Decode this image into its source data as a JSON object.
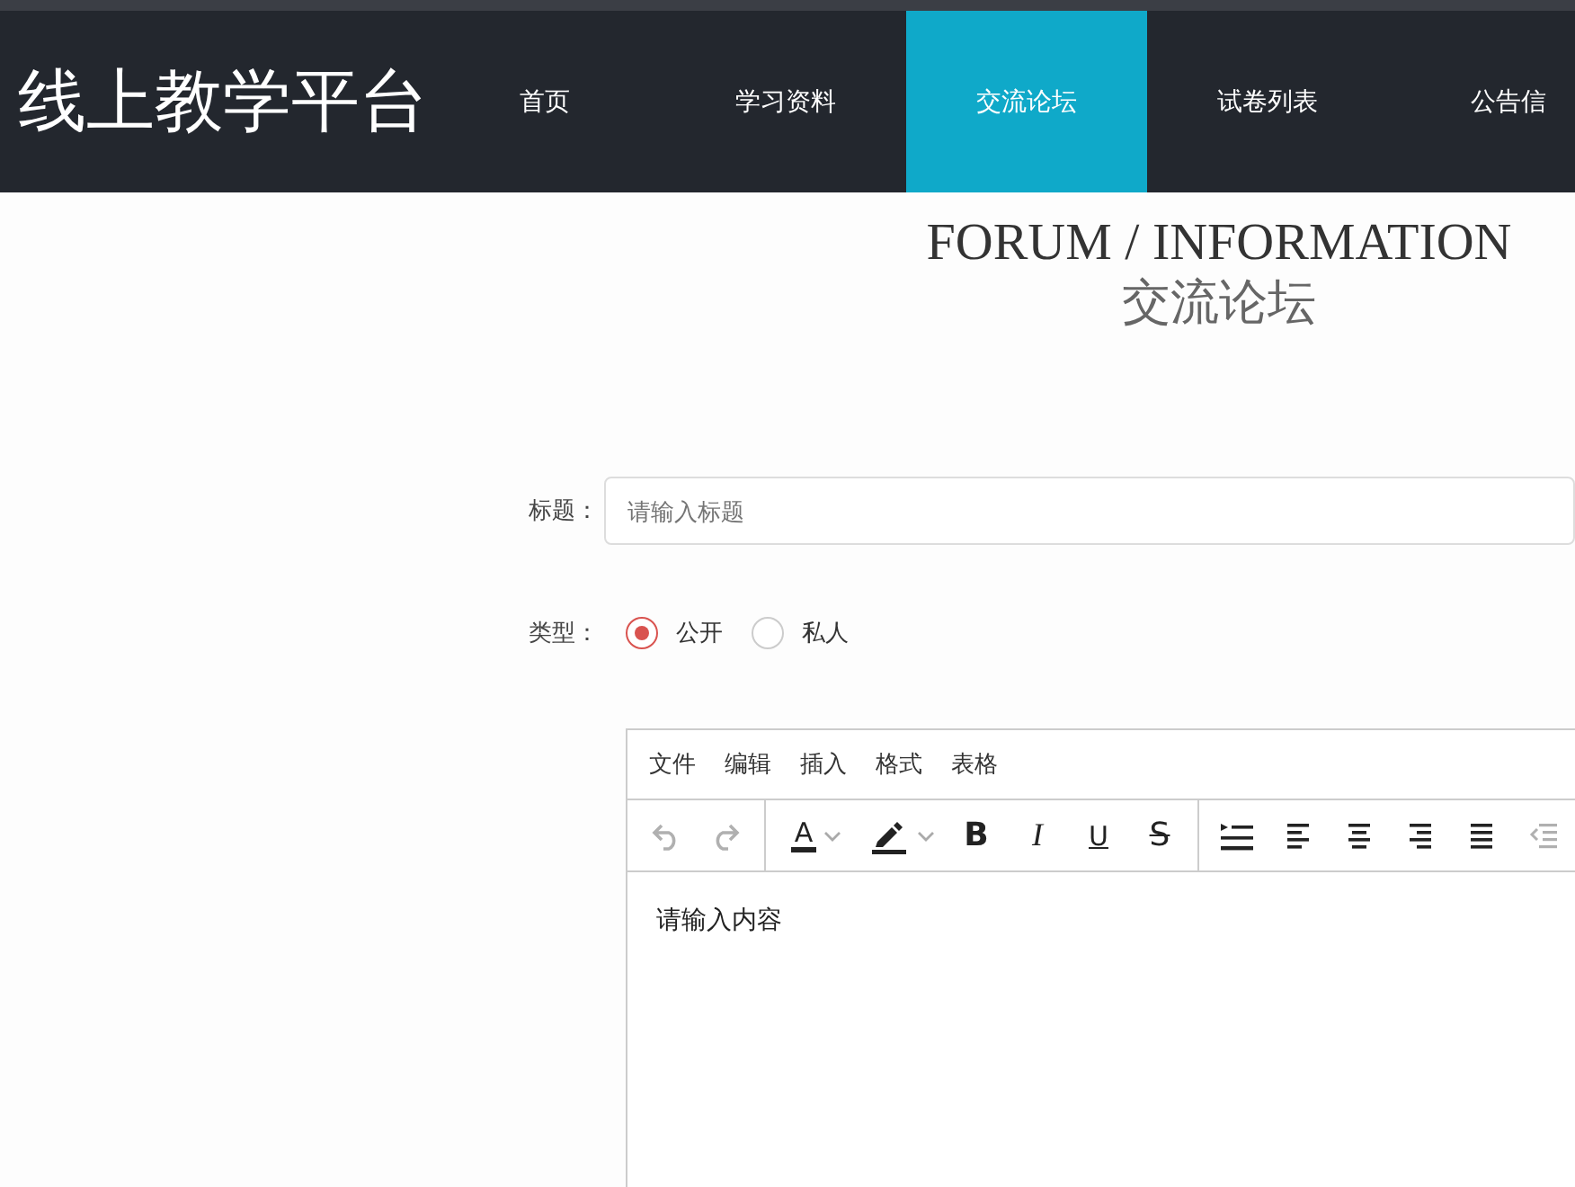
{
  "header": {
    "logo": "线上教学平台",
    "nav": [
      {
        "label": "首页",
        "selected": false
      },
      {
        "label": "学习资料",
        "selected": false
      },
      {
        "label": "交流论坛",
        "selected": true
      },
      {
        "label": "试卷列表",
        "selected": false
      },
      {
        "label": "公告信",
        "selected": false
      }
    ]
  },
  "heading": {
    "title": "FORUM / INFORMATION",
    "subtitle": "交流论坛"
  },
  "form": {
    "title_label": "标题：",
    "title_placeholder": "请输入标题",
    "type_label": "类型：",
    "types": [
      {
        "label": "公开",
        "selected": true
      },
      {
        "label": "私人",
        "selected": false
      }
    ]
  },
  "editor": {
    "menu": [
      "文件",
      "编辑",
      "插入",
      "格式",
      "表格"
    ],
    "toolbar": [
      [
        {
          "kind": "undo",
          "disabled": true
        },
        {
          "kind": "redo",
          "disabled": true
        }
      ],
      [
        {
          "kind": "text-color",
          "label": "A",
          "disabled": false
        },
        {
          "kind": "highlight",
          "disabled": false
        },
        {
          "kind": "bold",
          "label": "B",
          "disabled": false
        },
        {
          "kind": "italic",
          "label": "I",
          "disabled": false
        },
        {
          "kind": "underline",
          "label": "U",
          "disabled": false
        },
        {
          "kind": "strike",
          "label": "S",
          "disabled": false
        }
      ],
      [
        {
          "kind": "line-height",
          "disabled": false
        },
        {
          "kind": "align-left",
          "disabled": false
        },
        {
          "kind": "align-center",
          "disabled": false
        },
        {
          "kind": "align-right",
          "disabled": false
        },
        {
          "kind": "justify",
          "disabled": false
        },
        {
          "kind": "outdent",
          "disabled": true
        }
      ]
    ],
    "content": "请输入内容"
  }
}
